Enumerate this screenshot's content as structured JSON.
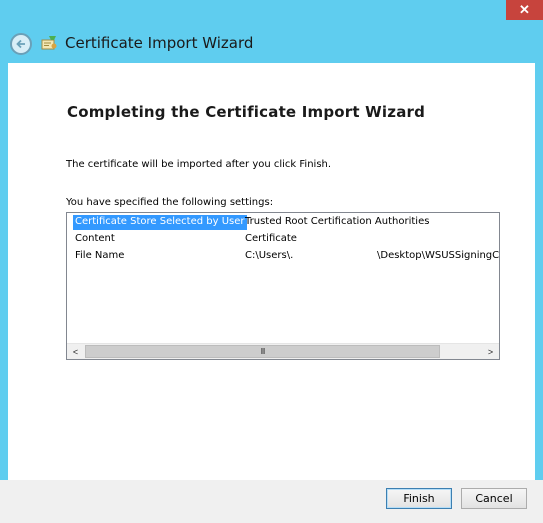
{
  "window": {
    "title": "Certificate Import Wizard",
    "close_label": "✕"
  },
  "page": {
    "heading": "Completing the Certificate Import Wizard",
    "description": "The certificate will be imported after you click Finish.",
    "settings_label": "You have specified the following settings:"
  },
  "settings": [
    {
      "name": "Certificate Store Selected by User",
      "value": "Trusted Root Certification Authorities",
      "value2": ""
    },
    {
      "name": "Content",
      "value": "Certificate",
      "value2": ""
    },
    {
      "name": "File Name",
      "value": "C:\\Users\\.",
      "value2": "\\Desktop\\WSUSSigningCe"
    }
  ],
  "scrollbar": {
    "left_arrow": "<",
    "right_arrow": ">",
    "thumb_grip": "III"
  },
  "buttons": {
    "finish": "Finish",
    "cancel": "Cancel"
  },
  "colors": {
    "frame": "#5fcdef",
    "close": "#c7443d",
    "selection": "#3399ff"
  }
}
